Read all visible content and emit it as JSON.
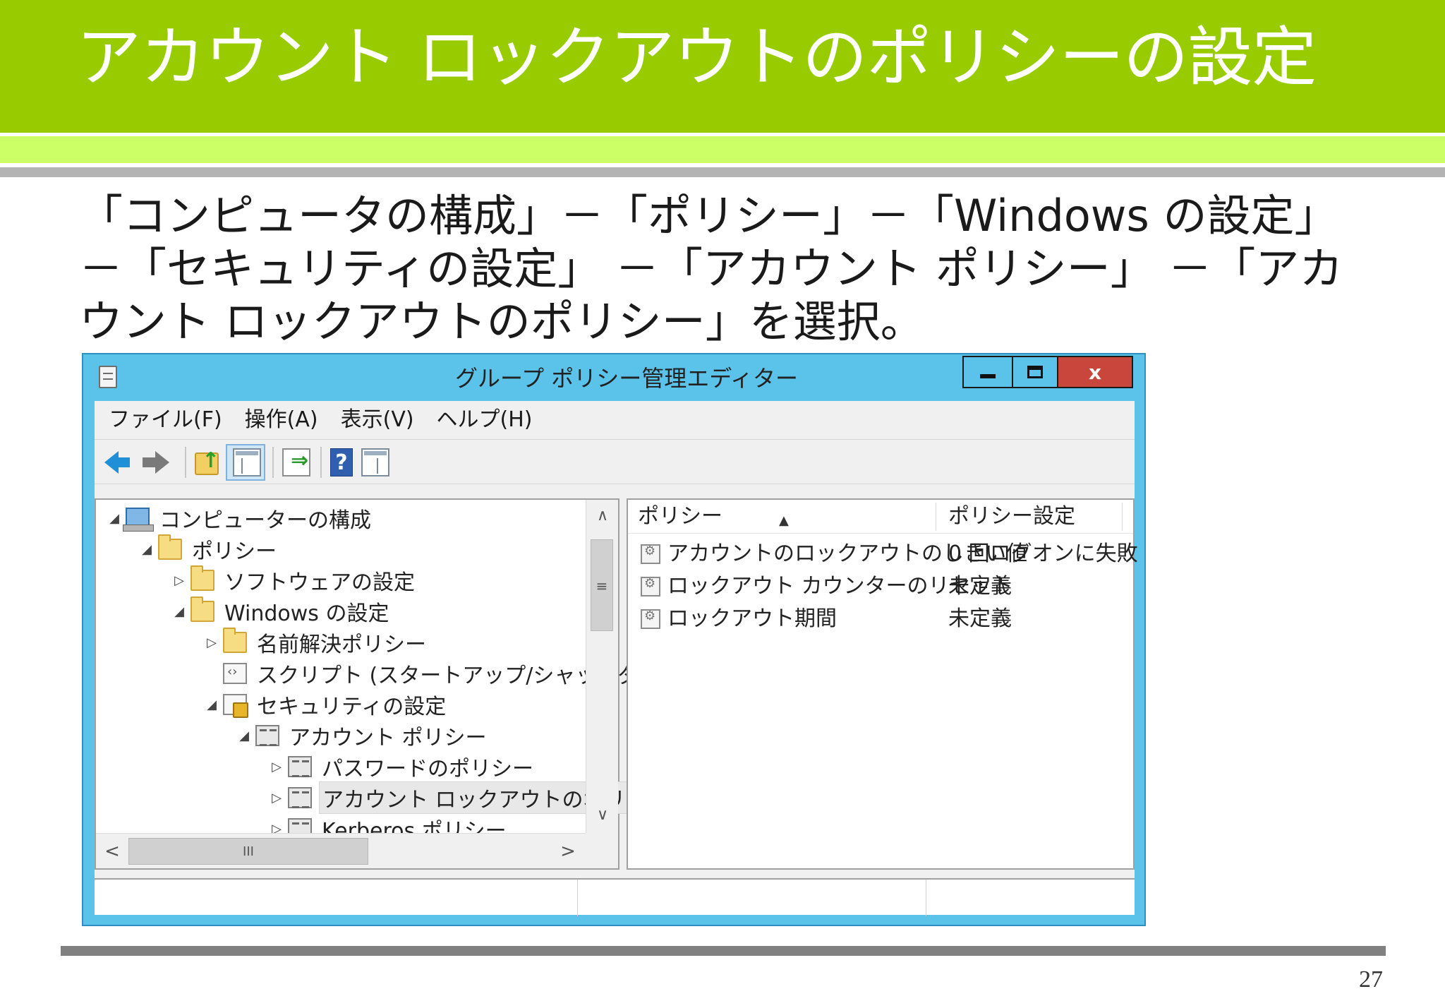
{
  "slide": {
    "title": "アカウント ロックアウトのポリシーの設定",
    "body_lines": [
      "「コンピュータの構成」－「ポリシー」－「Windows の設定」",
      "－「セキュリティの設定」 －「アカウント ポリシー」 －「アカ",
      "ウント ロックアウトのポリシー」を選択。"
    ],
    "page_number": "27"
  },
  "colors": {
    "header_green": "#99cc00",
    "stripe_lime": "#ccff66",
    "window_frame_blue": "#5bc3ea",
    "close_button_red": "#c9463d"
  },
  "window": {
    "title": "グループ ポリシー管理エディター",
    "close_glyph": "x",
    "menu": [
      "ファイル(F)",
      "操作(A)",
      "表示(V)",
      "ヘルプ(H)"
    ],
    "toolbar_icons": [
      "back-arrow-icon",
      "forward-arrow-icon",
      "up-folder-icon",
      "show-hide-console-tree-icon",
      "export-list-icon",
      "help-icon",
      "show-action-pane-icon"
    ],
    "help_glyph": "?",
    "tree": [
      {
        "label": "コンピューターの構成",
        "expander": "◢",
        "icon": "computer-icon"
      },
      {
        "label": "ポリシー",
        "expander": "◢",
        "icon": "folder-icon"
      },
      {
        "label": "ソフトウェアの設定",
        "expander": "▷",
        "icon": "folder-icon"
      },
      {
        "label": "Windows の設定",
        "expander": "◢",
        "icon": "folder-icon"
      },
      {
        "label": "名前解決ポリシー",
        "expander": "▷",
        "icon": "folder-icon"
      },
      {
        "label": "スクリプト (スタートアップ/シャットダウン)",
        "expander": "",
        "icon": "script-icon"
      },
      {
        "label": "セキュリティの設定",
        "expander": "◢",
        "icon": "security-icon"
      },
      {
        "label": "アカウント ポリシー",
        "expander": "◢",
        "icon": "policy-icon"
      },
      {
        "label": "パスワードのポリシー",
        "expander": "▷",
        "icon": "policy-icon"
      },
      {
        "label": "アカウント ロックアウトのポリシー",
        "expander": "▷",
        "icon": "policy-icon",
        "selected": true
      },
      {
        "label": "Kerberos ポリシー",
        "expander": "▷",
        "icon": "policy-icon"
      }
    ],
    "scroll": {
      "up": "∧",
      "down": "∨",
      "left": "<",
      "right": ">",
      "v_grip": "≡",
      "h_grip": "III"
    },
    "list": {
      "columns": [
        "ポリシー",
        "ポリシー設定"
      ],
      "sort_glyph": "▲",
      "rows": [
        {
          "name": "アカウントのロックアウトのしきい値",
          "value": "0 回ログオンに失敗"
        },
        {
          "name": "ロックアウト カウンターのリセット",
          "value": "未定義"
        },
        {
          "name": "ロックアウト期間",
          "value": "未定義"
        }
      ]
    }
  }
}
